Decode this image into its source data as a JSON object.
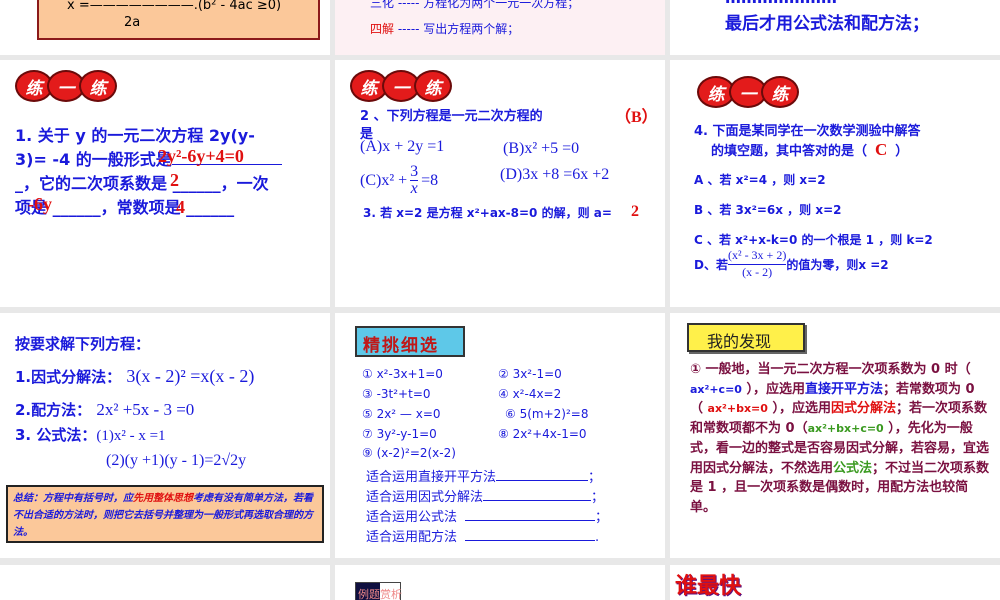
{
  "top": {
    "s1": {
      "formula": "x =————————.(b² - 4ac ≥0)",
      "denom": "2a"
    },
    "s2": {
      "line1": "三化 ----- 方程化为两个一元一次方程；",
      "line2_head": "四解",
      "line2": " ----- 写出方程两个解；"
    },
    "s3": {
      "line1": "…………………",
      "line2": "最后才用公式法和配方法；"
    }
  },
  "badge": [
    "练",
    "一",
    "练"
  ],
  "q1": {
    "line1": "1. 关于 y 的一元二次方程 2y(y-",
    "line2": "3)= -4 的一般形式是",
    "line3": "_，它的二次项系数是 ______，一次",
    "line4": "项是 ______，常数项是 ______",
    "ans_general": "2y²-6y+4=0",
    "ans_quad": "2",
    "ans_linear": "-6y",
    "ans_const": "4"
  },
  "q2": {
    "title": "2 、下列方程是一元二次方程的",
    "title2": "是",
    "answer": "（B）",
    "A": "(A)x + 2y =1",
    "B": "(B)x² +5 =0",
    "C": "(C)x² + 3/x =8",
    "C_pre": "(C)x² +",
    "C_num": "3",
    "C_den": "x",
    "C_post": "=8",
    "D": "(D)3x +8 =6x +2",
    "q3": "3. 若 x=2 是方程 x²+ax-8=0 的解，则 a=",
    "q3_ans": "2"
  },
  "q4": {
    "title1": "4. 下面是某同学在一次数学测验中解答",
    "title2": "的填空题，其中答对的是（",
    "title_end": "）",
    "answer": "C",
    "A": "A 、若 x²=4 ，则 x=2",
    "B": "B 、若 3x²=6x ，则 x=2",
    "C": "C 、若 x²+x-k=0 的一个根是 1 ，则 k=2",
    "D_pre": "D、若",
    "D_num": "(x² - 3x + 2)",
    "D_den": "(x - 2)",
    "D_post": "的值为零，则x =2"
  },
  "solve": {
    "title": "按要求解下列方程：",
    "m1_label": "1.因式分解法：",
    "m1_eq": "3(x - 2)² =x(x - 2)",
    "m2_label": "2.配方法：",
    "m2_eq": "2x² +5x - 3 =0",
    "m3_label": "3. 公式法：",
    "m3_eq1": "(1)x² - x =1",
    "m3_eq2": "(2)(y +1)(y - 1)=2√2y",
    "summary_a": "总结：方程中有括号时，应",
    "summary_hl": "先用整体思想",
    "summary_b": "考虑有没有简单方法，若看不出合适的方法时，则把它去括号并整理为一般形式再选取合理的方法。"
  },
  "select": {
    "badge": "精挑细选",
    "eqs": [
      "①   x²-3x+1=0",
      "②   3x²-1=0",
      "③   -3t²+t=0",
      "④   x²-4x=2",
      "⑤   2x² — x=0",
      "⑥   5(m+2)²=8",
      "⑦   3y²-y-1=0",
      "⑧   2x²+4x-1=0",
      "⑨  (x-2)²=2(x-2)"
    ],
    "fills": [
      "适合运用直接开平方法",
      "适合运用因式分解法",
      "适合运用公式法",
      "适合运用配方法"
    ],
    "ends": [
      "；",
      "；",
      "；",
      "."
    ]
  },
  "discover": {
    "badge": "我的发现",
    "p1": "① 一般地，当一元二次方程一次项系数为 0 时（ ",
    "f1": "ax²+c=0",
    "p2": " ），应选用",
    "h1": "直接开平方法",
    "p3": "；若常数项为 0 （ ",
    "f2": "ax²+bx=0",
    "p4": " ），应选用",
    "h2": "因式分解法",
    "p5": "；若一次项系数和常数项都不为 0（",
    "f3": "ax²+bx+c=0",
    "p6": " ），先化为一般式，看一边的整式是否容易因式分解，若容易，宜选用因式分解法，不然选用",
    "h3": "公式法",
    "p7": "；不过当二次项系数是 1 ，且一次项系数是偶数时，用配方法也较简单。"
  },
  "bottom": {
    "mid_badge": "例题赏析",
    "right_title": "谁最快"
  },
  "colors": {
    "blue": "#1a1adb",
    "red": "#e01010",
    "maroon": "#7a1040",
    "green": "#3a9a20",
    "orange_box": "#fbc89a",
    "yellow_badge": "#fff04a",
    "gap": "#e8e8e8"
  }
}
